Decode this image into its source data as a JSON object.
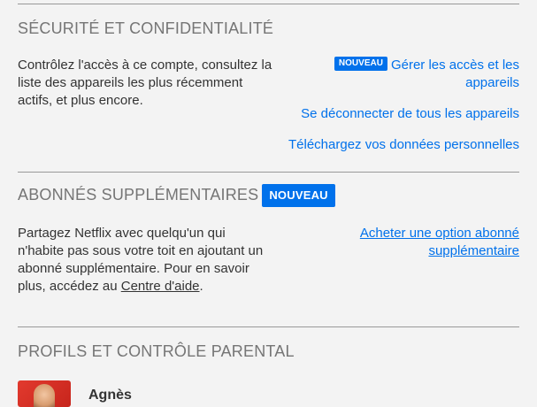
{
  "security": {
    "heading": "SÉCURITÉ ET CONFIDENTIALITÉ",
    "description": "Contrôlez l'accès à ce compte, consultez la liste des appareils les plus récemment actifs, et plus encore.",
    "badge": "NOUVEAU",
    "links": {
      "manage_access": "Gérer les accès et les appareils",
      "sign_out_all": "Se déconnecter de tous les appareils",
      "download_data": "Téléchargez vos données personnelles"
    }
  },
  "extra_members": {
    "heading": "ABONNÉS SUPPLÉMENTAIRES",
    "badge": "NOUVEAU",
    "description_before": "Partagez Netflix avec quelqu'un qui n'habite pas sous votre toit en ajoutant un abonné supplémentaire. Pour en savoir plus, accédez au ",
    "help_link": "Centre d'aide",
    "description_after": ".",
    "buy_link": "Acheter une option abonné supplémentaire"
  },
  "profiles": {
    "heading": "PROFILS ET CONTRÔLE PARENTAL",
    "first_profile_name": "Agnès"
  },
  "colors": {
    "background": "#f3f3f3",
    "link": "#0071eb",
    "heading": "#757575",
    "badge": "#0071eb"
  }
}
